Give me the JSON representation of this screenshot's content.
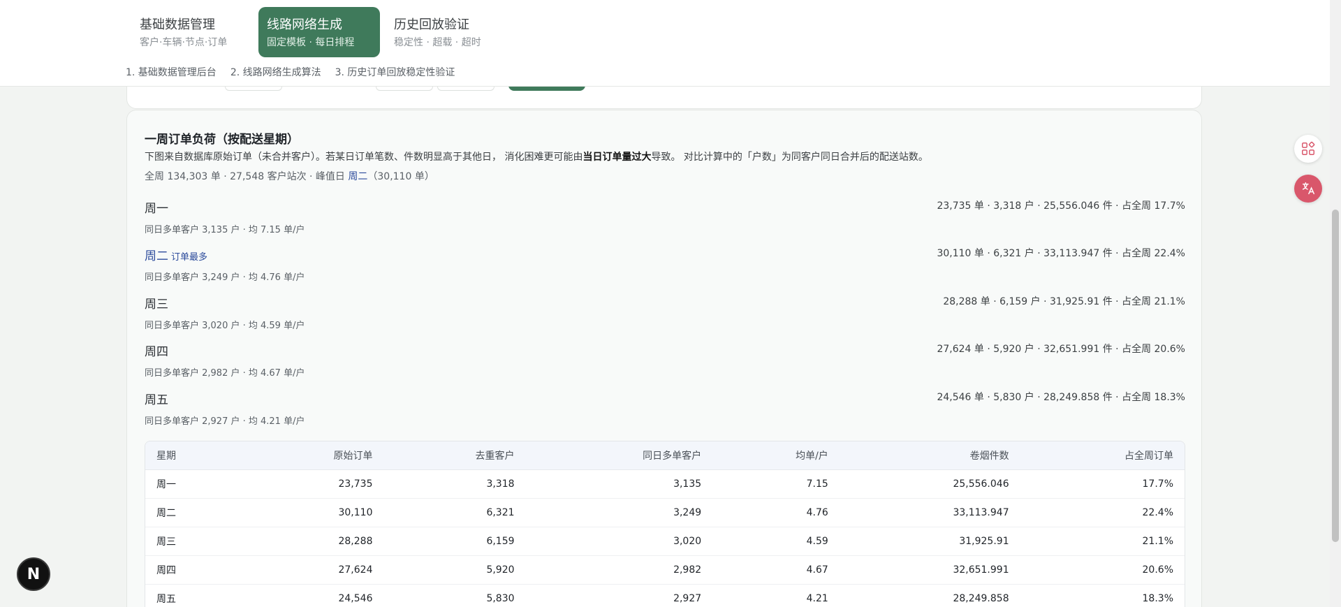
{
  "header": {
    "tabs": [
      {
        "label": "基础数据管理",
        "sub": "客户·车辆·节点·订单"
      },
      {
        "label": "线路网络生成",
        "sub": "固定模板 · 每日排程"
      },
      {
        "label": "历史回放验证",
        "sub": "稳定性 · 超载 · 超时"
      }
    ],
    "crumbs": [
      "1. 基础数据管理后台",
      "2. 线路网络生成算法",
      "3. 历史订单回放稳定性验证"
    ]
  },
  "section": {
    "title": "一周订单负荷（按配送星期）",
    "desc_a": "下图来自数据库原始订单（未合并客户）。若某日订单笔数、件数明显高于其他日， 消化困难更可能由",
    "desc_b": "当日订单量过大",
    "desc_c": "导致。 对比计算中的「户数」为同客户同日合并后的配送站数。",
    "summary_a": "全周 134,303 单 · 27,548 客户站次 · 峰值日 ",
    "summary_peak": "周二",
    "summary_b": "（30,110 单）"
  },
  "days": [
    {
      "name": "周一",
      "badge": "",
      "sub": "同日多单客户 3,135 户 · 均 7.15 单/户",
      "stats": "23,735 单 · 3,318 户 · 25,556.046 件 · 占全周 17.7%"
    },
    {
      "name": "周二",
      "badge": "订单最多",
      "sub": "同日多单客户 3,249 户 · 均 4.76 单/户",
      "stats": "30,110 单 · 6,321 户 · 33,113.947 件 · 占全周 22.4%"
    },
    {
      "name": "周三",
      "badge": "",
      "sub": "同日多单客户 3,020 户 · 均 4.59 单/户",
      "stats": "28,288 单 · 6,159 户 · 31,925.91 件 · 占全周 21.1%"
    },
    {
      "name": "周四",
      "badge": "",
      "sub": "同日多单客户 2,982 户 · 均 4.67 单/户",
      "stats": "27,624 单 · 5,920 户 · 32,651.991 件 · 占全周 20.6%"
    },
    {
      "name": "周五",
      "badge": "",
      "sub": "同日多单客户 2,927 户 · 均 4.21 单/户",
      "stats": "24,546 单 · 5,830 户 · 28,249.858 件 · 占全周 18.3%"
    }
  ],
  "table": {
    "headers": [
      "星期",
      "原始订单",
      "去重客户",
      "同日多单客户",
      "均单/户",
      "卷烟件数",
      "占全周订单"
    ],
    "rows": [
      [
        "周一",
        "23,735",
        "3,318",
        "3,135",
        "7.15",
        "25,556.046",
        "17.7%"
      ],
      [
        "周二",
        "30,110",
        "6,321",
        "3,249",
        "4.76",
        "33,113.947",
        "22.4%"
      ],
      [
        "周三",
        "28,288",
        "6,159",
        "3,020",
        "4.59",
        "31,925.91",
        "21.1%"
      ],
      [
        "周四",
        "27,624",
        "5,920",
        "2,982",
        "4.67",
        "32,651.991",
        "20.6%"
      ],
      [
        "周五",
        "24,546",
        "5,830",
        "2,927",
        "4.21",
        "28,249.858",
        "18.3%"
      ]
    ]
  },
  "icons": {
    "apps": "apps-grid-icon",
    "translate": "translate-icon",
    "brand": "N"
  },
  "colors": {
    "accent": "#3f7a5b",
    "peak": "#2b4a9b",
    "translate_bg": "#d9576b"
  }
}
